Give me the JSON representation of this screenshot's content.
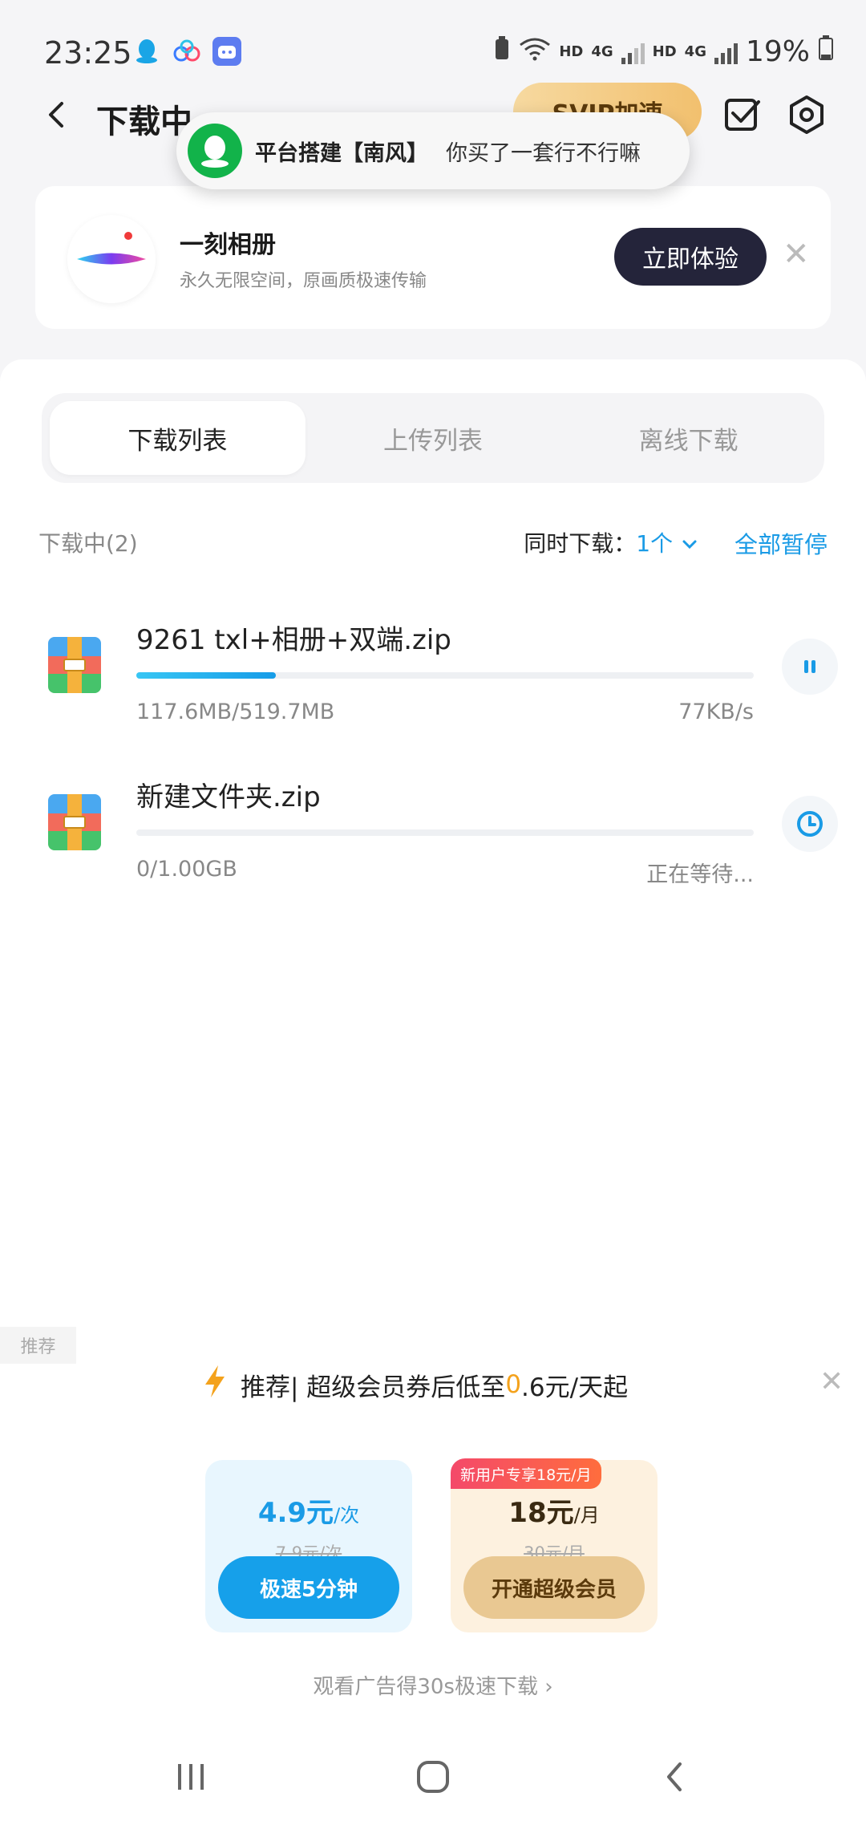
{
  "status_bar": {
    "time": "23:25",
    "hd1": "HD",
    "net1": "4G",
    "hd2": "HD",
    "net2": "4G",
    "battery": "19%"
  },
  "header": {
    "title": "下载中",
    "vip_label": "SVIP加速",
    "icons": [
      "back-icon",
      "check-square-icon",
      "settings-icon"
    ]
  },
  "toast": {
    "name": "平台搭建【南风】",
    "message": "你买了一套行不行嘛"
  },
  "ad": {
    "title": "一刻相册",
    "subtitle": "永久无限空间，原画质极速传输",
    "button": "立即体验"
  },
  "tabs": [
    {
      "label": "下载列表",
      "active": true
    },
    {
      "label": "上传列表",
      "active": false
    },
    {
      "label": "离线下载",
      "active": false
    }
  ],
  "list_header": {
    "count_label": "下载中(2)",
    "concurrent_label": "同时下载：",
    "concurrent_value": "1个",
    "pause_all": "全部暂停"
  },
  "downloads": [
    {
      "name": "9261 txl+相册+双端.zip",
      "size": "117.6MB/519.7MB",
      "status": "77KB/s",
      "progress": 0.226,
      "action": "pause-icon"
    },
    {
      "name": "新建文件夹.zip",
      "size": "0/1.00GB",
      "status": "正在等待...",
      "progress": 0.0,
      "action": "clock-icon"
    }
  ],
  "promo": {
    "tag": "推荐",
    "line_prefix": "推荐| 超级会员券后低至",
    "line_num": "0",
    "line_suffix": ".6元/天起",
    "card1": {
      "price": "4.9元",
      "unit": "/次",
      "old_price": "7.9元/次",
      "button": "极速5分钟"
    },
    "card2": {
      "badge": "新用户专享18元/月",
      "price": "18元",
      "unit": "/月",
      "old_price": "30元/月",
      "button": "开通超级会员"
    },
    "link": "观看广告得30s极速下载 ›"
  },
  "colors": {
    "accent": "#1a9be6",
    "vip_gold": "#f2c06e",
    "dark_button": "#24243a"
  }
}
